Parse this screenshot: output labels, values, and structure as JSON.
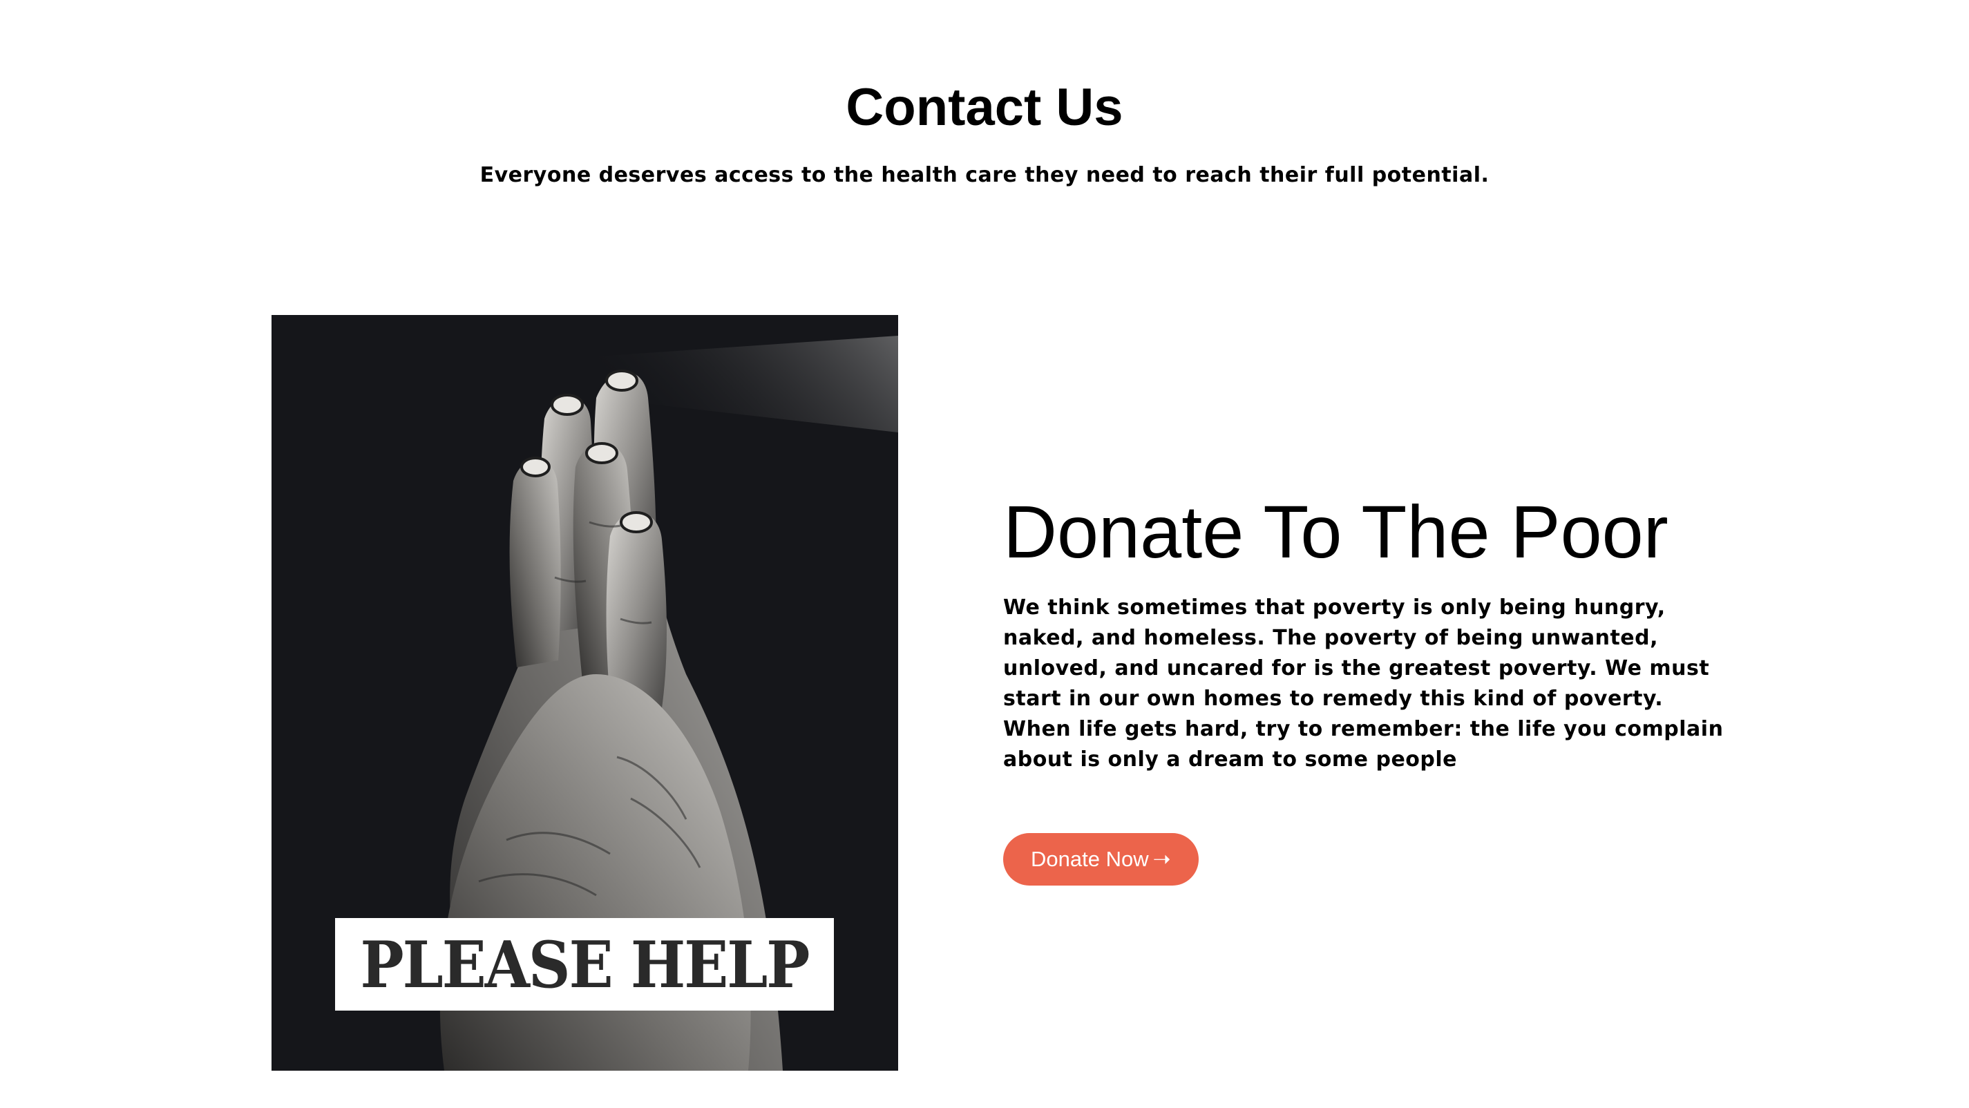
{
  "header": {
    "title": "Contact Us",
    "subtitle": "Everyone deserves access to the health care they need to reach their full potential."
  },
  "poster": {
    "banner_text": "PLEASE HELP",
    "image_description": "praying-hands-photo"
  },
  "donate_section": {
    "title": "Donate To The Poor",
    "paragraph_1": "We think sometimes that poverty is only being hungry, naked, and homeless. The poverty of being unwanted, unloved, and uncared for is the greatest poverty. We must start in our own homes to remedy this kind of poverty.",
    "paragraph_2": "When life gets hard, try to remember: the life you complain about is only a dream to some people",
    "button_label": "Donate Now",
    "button_icon": "arrow-right-icon"
  },
  "colors": {
    "accent": "#ec644b",
    "text": "#000000",
    "background": "#ffffff"
  }
}
